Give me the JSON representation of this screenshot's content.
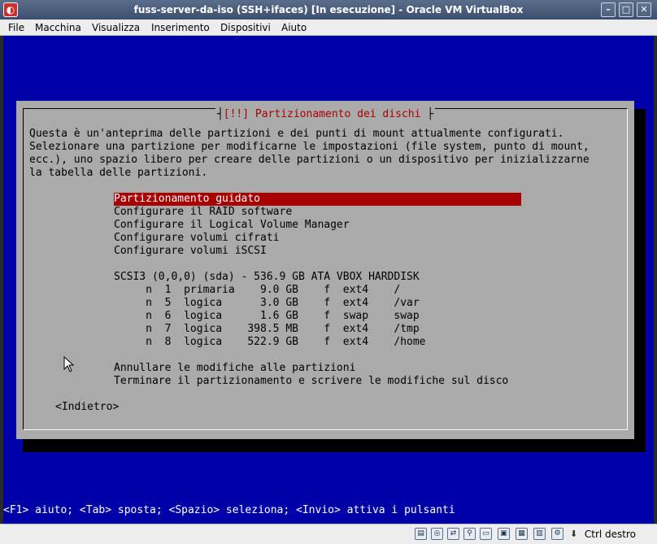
{
  "window": {
    "title": "fuss-server-da-iso (SSH+ifaces) [In esecuzione] - Oracle VM VirtualBox",
    "min": "–",
    "max": "□",
    "close": "✕"
  },
  "menu": [
    "File",
    "Macchina",
    "Visualizza",
    "Inserimento",
    "Dispositivi",
    "Aiuto"
  ],
  "dialog": {
    "title": "[!!] Partizionamento dei dischi",
    "intro": [
      "Questa è un'anteprima delle partizioni e dei punti di mount attualmente configurati.",
      "Selezionare una partizione per modificarne le impostazioni (file system, punto di mount,",
      "ecc.), uno spazio libero per creare delle partizioni o un dispositivo per inizializzarne",
      "la tabella delle partizioni."
    ],
    "options": [
      "Partizionamento guidato                                         ",
      "Configurare il RAID software",
      "Configurare il Logical Volume Manager",
      "Configurare volumi cifrati",
      "Configurare volumi iSCSI"
    ],
    "disk": "SCSI3 (0,0,0) (sda) - 536.9 GB ATA VBOX HARDDISK",
    "partitions": [
      "     n  1  primaria    9.0 GB    f  ext4    /",
      "     n  5  logica      3.0 GB    f  ext4    /var",
      "     n  6  logica      1.6 GB    f  swap    swap",
      "     n  7  logica    398.5 MB    f  ext4    /tmp",
      "     n  8  logica    522.9 GB    f  ext4    /home"
    ],
    "actions": [
      "Annullare le modifiche alle partizioni",
      "Terminare il partizionamento e scrivere le modifiche sul disco"
    ],
    "back": "<Indietro>"
  },
  "statusline": "<F1> aiuto; <Tab> sposta; <Spazio> seleziona; <Invio> attiva i pulsanti",
  "statusbar": {
    "hostkey": "Ctrl destro",
    "icons": [
      "hdd-icon",
      "optical-icon",
      "network-icon",
      "usb-icon",
      "shared-folder-icon",
      "display-icon",
      "screen-icon",
      "recording-icon",
      "cpu-icon",
      "mouse-icon",
      "arrow-icon"
    ]
  }
}
